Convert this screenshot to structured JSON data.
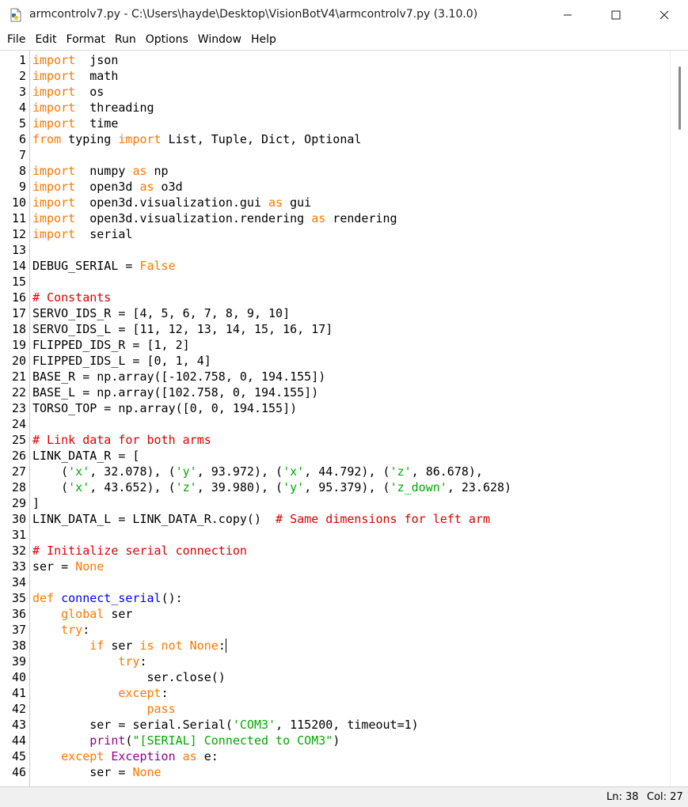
{
  "window": {
    "title": "armcontrolv7.py - C:\\Users\\hayde\\Desktop\\VisionBotV4\\armcontrolv7.py (3.10.0)",
    "icon": "python-file-icon",
    "minimize_icon": "minimize-icon",
    "maximize_icon": "maximize-icon",
    "close_icon": "close-icon"
  },
  "menu": {
    "items": [
      "File",
      "Edit",
      "Format",
      "Run",
      "Options",
      "Window",
      "Help"
    ]
  },
  "syntax_colors": {
    "keyword": "#ff7700",
    "comment": "#dd0000",
    "string": "#00aa00",
    "definition": "#0000ff",
    "builtin": "#900090",
    "plain": "#000000"
  },
  "editor": {
    "line_numbers": [
      "1",
      "2",
      "3",
      "4",
      "5",
      "6",
      "7",
      "8",
      "9",
      "10",
      "11",
      "12",
      "13",
      "14",
      "15",
      "16",
      "17",
      "18",
      "19",
      "20",
      "21",
      "22",
      "23",
      "24",
      "25",
      "26",
      "27",
      "28",
      "29",
      "30",
      "31",
      "32",
      "33",
      "34",
      "35",
      "36",
      "37",
      "38",
      "39",
      "40",
      "41",
      "42",
      "43",
      "44",
      "45",
      "46"
    ],
    "lines": [
      [
        [
          "kw",
          "import"
        ],
        [
          "",
          "  json"
        ]
      ],
      [
        [
          "kw",
          "import"
        ],
        [
          "",
          "  math"
        ]
      ],
      [
        [
          "kw",
          "import"
        ],
        [
          "",
          "  os"
        ]
      ],
      [
        [
          "kw",
          "import"
        ],
        [
          "",
          "  threading"
        ]
      ],
      [
        [
          "kw",
          "import"
        ],
        [
          "",
          "  time"
        ]
      ],
      [
        [
          "kw",
          "from"
        ],
        [
          "",
          " typing "
        ],
        [
          "kw",
          "import"
        ],
        [
          "",
          " List, Tuple, Dict, Optional"
        ]
      ],
      [],
      [
        [
          "kw",
          "import"
        ],
        [
          "",
          "  numpy "
        ],
        [
          "kw",
          "as"
        ],
        [
          "",
          " np"
        ]
      ],
      [
        [
          "kw",
          "import"
        ],
        [
          "",
          "  open3d "
        ],
        [
          "kw",
          "as"
        ],
        [
          "",
          " o3d"
        ]
      ],
      [
        [
          "kw",
          "import"
        ],
        [
          "",
          "  open3d.visualization.gui "
        ],
        [
          "kw",
          "as"
        ],
        [
          "",
          " gui"
        ]
      ],
      [
        [
          "kw",
          "import"
        ],
        [
          "",
          "  open3d.visualization.rendering "
        ],
        [
          "kw",
          "as"
        ],
        [
          "",
          " rendering"
        ]
      ],
      [
        [
          "kw",
          "import"
        ],
        [
          "",
          "  serial"
        ]
      ],
      [],
      [
        [
          "",
          "DEBUG_SERIAL = "
        ],
        [
          "kw",
          "False"
        ]
      ],
      [],
      [
        [
          "cm",
          "# Constants"
        ]
      ],
      [
        [
          "",
          "SERVO_IDS_R = [4, 5, 6, 7, 8, 9, 10]"
        ]
      ],
      [
        [
          "",
          "SERVO_IDS_L = [11, 12, 13, 14, 15, 16, 17]"
        ]
      ],
      [
        [
          "",
          "FLIPPED_IDS_R = [1, 2]"
        ]
      ],
      [
        [
          "",
          "FLIPPED_IDS_L = [0, 1, 4]"
        ]
      ],
      [
        [
          "",
          "BASE_R = np.array([-102.758, 0, 194.155])"
        ]
      ],
      [
        [
          "",
          "BASE_L = np.array([102.758, 0, 194.155])"
        ]
      ],
      [
        [
          "",
          "TORSO_TOP = np.array([0, 0, 194.155])"
        ]
      ],
      [],
      [
        [
          "cm",
          "# Link data for both arms"
        ]
      ],
      [
        [
          "",
          "LINK_DATA_R = ["
        ]
      ],
      [
        [
          "",
          "    ("
        ],
        [
          "st",
          "'x'"
        ],
        [
          "",
          ", 32.078), ("
        ],
        [
          "st",
          "'y'"
        ],
        [
          "",
          ", 93.972), ("
        ],
        [
          "st",
          "'x'"
        ],
        [
          "",
          ", 44.792), ("
        ],
        [
          "st",
          "'z'"
        ],
        [
          "",
          ", 86.678),"
        ]
      ],
      [
        [
          "",
          "    ("
        ],
        [
          "st",
          "'x'"
        ],
        [
          "",
          ", 43.652), ("
        ],
        [
          "st",
          "'z'"
        ],
        [
          "",
          ", 39.980), ("
        ],
        [
          "st",
          "'y'"
        ],
        [
          "",
          ", 95.379), ("
        ],
        [
          "st",
          "'z_down'"
        ],
        [
          "",
          ", 23.628)"
        ]
      ],
      [
        [
          "",
          "]"
        ]
      ],
      [
        [
          "",
          "LINK_DATA_L = LINK_DATA_R.copy()  "
        ],
        [
          "cm",
          "# Same dimensions for left arm"
        ]
      ],
      [],
      [
        [
          "cm",
          "# Initialize serial connection"
        ]
      ],
      [
        [
          "",
          "ser = "
        ],
        [
          "kw",
          "None"
        ]
      ],
      [],
      [
        [
          "kw",
          "def"
        ],
        [
          "",
          " "
        ],
        [
          "df",
          "connect_serial"
        ],
        [
          "",
          "():"
        ]
      ],
      [
        [
          "",
          "    "
        ],
        [
          "kw",
          "global"
        ],
        [
          "",
          " ser"
        ]
      ],
      [
        [
          "",
          "    "
        ],
        [
          "kw",
          "try"
        ],
        [
          "",
          ":"
        ]
      ],
      [
        [
          "",
          "        "
        ],
        [
          "kw",
          "if"
        ],
        [
          "",
          " ser "
        ],
        [
          "kw",
          "is not None"
        ],
        [
          "",
          ":"
        ]
      ],
      [
        [
          "",
          "            "
        ],
        [
          "kw",
          "try"
        ],
        [
          "",
          ":"
        ]
      ],
      [
        [
          "",
          "                ser.close()"
        ]
      ],
      [
        [
          "",
          "            "
        ],
        [
          "kw",
          "except"
        ],
        [
          "",
          ":"
        ]
      ],
      [
        [
          "",
          "                "
        ],
        [
          "kw",
          "pass"
        ]
      ],
      [
        [
          "",
          "        ser = serial.Serial("
        ],
        [
          "st",
          "'COM3'"
        ],
        [
          "",
          ", 115200, timeout=1)"
        ]
      ],
      [
        [
          "",
          "        "
        ],
        [
          "bi",
          "print"
        ],
        [
          "",
          "("
        ],
        [
          "st",
          "\"[SERIAL] Connected to COM3\""
        ],
        [
          "",
          ")"
        ]
      ],
      [
        [
          "",
          "    "
        ],
        [
          "kw",
          "except"
        ],
        [
          "",
          " "
        ],
        [
          "bi",
          "Exception"
        ],
        [
          "",
          " "
        ],
        [
          "kw",
          "as"
        ],
        [
          "",
          " e:"
        ]
      ],
      [
        [
          "",
          "        ser = "
        ],
        [
          "kw",
          "None"
        ]
      ]
    ],
    "cursor": {
      "line": 38,
      "col": 27
    }
  },
  "status": {
    "ln": "Ln: 38",
    "col": "Col: 27"
  }
}
